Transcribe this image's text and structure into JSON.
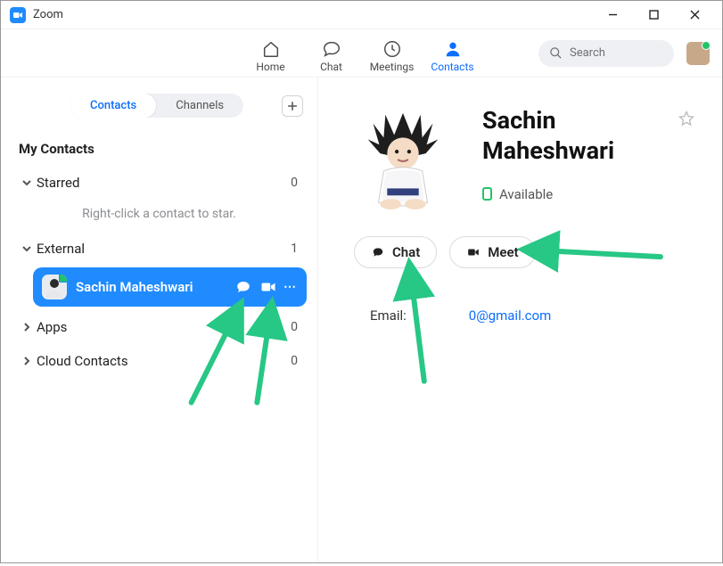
{
  "window": {
    "title": "Zoom"
  },
  "nav": {
    "tabs": [
      {
        "label": "Home"
      },
      {
        "label": "Chat"
      },
      {
        "label": "Meetings"
      },
      {
        "label": "Contacts"
      }
    ],
    "active_tab_index": 3,
    "search_placeholder": "Search"
  },
  "sidebar": {
    "views": {
      "contacts": "Contacts",
      "channels": "Channels"
    },
    "active_view": "contacts",
    "heading": "My Contacts",
    "star_hint": "Right-click a contact to star.",
    "sections": {
      "starred": {
        "label": "Starred",
        "count": "0",
        "expanded": true
      },
      "external": {
        "label": "External",
        "count": "1",
        "expanded": true
      },
      "apps": {
        "label": "Apps",
        "count": "0",
        "expanded": false
      },
      "cloud_contacts": {
        "label": "Cloud Contacts",
        "count": "0",
        "expanded": false
      }
    },
    "selected_contact": {
      "name": "Sachin Maheshwari"
    }
  },
  "detail": {
    "name": "Sachin Maheshwari",
    "status_text": "Available",
    "buttons": {
      "chat": "Chat",
      "meet": "Meet"
    },
    "email_label": "Email:",
    "email_value": "0@gmail.com"
  }
}
